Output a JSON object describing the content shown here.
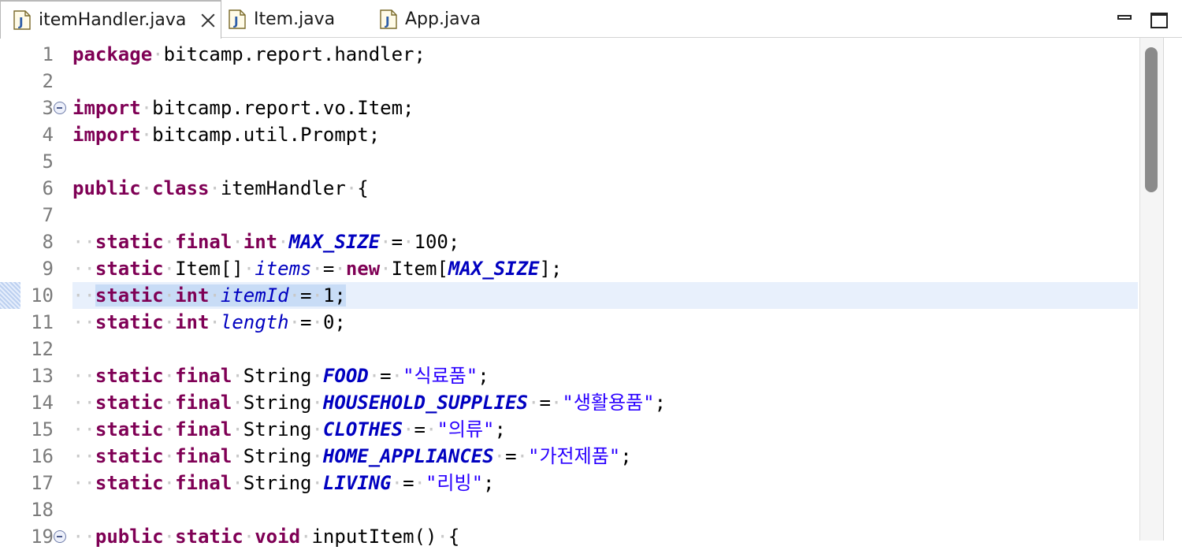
{
  "tabs": [
    {
      "label": "itemHandler.java",
      "active": true
    },
    {
      "label": "Item.java",
      "active": false
    },
    {
      "label": "App.java",
      "active": false
    }
  ],
  "icons": {
    "file": "java-file-icon",
    "close": "close-icon",
    "minimize": "minimize-icon",
    "maximize": "maximize-icon"
  },
  "colors": {
    "keyword": "#7f0055",
    "field": "#0000c0",
    "string": "#2a00ff",
    "current_line": "#e8f0fc"
  },
  "editor": {
    "current_line": 10,
    "lines": [
      {
        "n": "1",
        "tokens": [
          [
            "kw",
            "package"
          ],
          [
            "ws",
            "·"
          ],
          [
            "",
            "bitcamp.report.handler;"
          ]
        ]
      },
      {
        "n": "2",
        "tokens": []
      },
      {
        "n": "3",
        "fold": true,
        "tokens": [
          [
            "kw",
            "import"
          ],
          [
            "ws",
            "·"
          ],
          [
            "",
            "bitcamp.report.vo.Item;"
          ]
        ]
      },
      {
        "n": "4",
        "tokens": [
          [
            "kw",
            "import"
          ],
          [
            "ws",
            "·"
          ],
          [
            "",
            "bitcamp.util.Prompt;"
          ]
        ]
      },
      {
        "n": "5",
        "tokens": []
      },
      {
        "n": "6",
        "tokens": [
          [
            "kw",
            "public"
          ],
          [
            "ws",
            "·"
          ],
          [
            "kw",
            "class"
          ],
          [
            "ws",
            "·"
          ],
          [
            "",
            "itemHandler"
          ],
          [
            "ws",
            "·"
          ],
          [
            "",
            "{"
          ]
        ]
      },
      {
        "n": "7",
        "tokens": []
      },
      {
        "n": "8",
        "tokens": [
          [
            "ws",
            "··"
          ],
          [
            "kw",
            "static"
          ],
          [
            "ws",
            "·"
          ],
          [
            "kw",
            "final"
          ],
          [
            "ws",
            "·"
          ],
          [
            "kw",
            "int"
          ],
          [
            "ws",
            "·"
          ],
          [
            "fsi",
            "MAX_SIZE"
          ],
          [
            "ws",
            "·"
          ],
          [
            "",
            "="
          ],
          [
            "ws",
            "·"
          ],
          [
            "",
            "100;"
          ]
        ]
      },
      {
        "n": "9",
        "tokens": [
          [
            "ws",
            "··"
          ],
          [
            "kw",
            "static"
          ],
          [
            "ws",
            "·"
          ],
          [
            "",
            "Item[]"
          ],
          [
            "ws",
            "·"
          ],
          [
            "fi",
            "items"
          ],
          [
            "ws",
            "·"
          ],
          [
            "",
            "="
          ],
          [
            "ws",
            "·"
          ],
          [
            "kw",
            "new"
          ],
          [
            "ws",
            "·"
          ],
          [
            "",
            "Item["
          ],
          [
            "fsi",
            "MAX_SIZE"
          ],
          [
            "",
            "];"
          ]
        ]
      },
      {
        "n": "10",
        "tokens": [
          [
            "ws",
            "··"
          ],
          [
            "kw sel",
            "static"
          ],
          [
            "ws sel",
            "·"
          ],
          [
            "kw sel",
            "int"
          ],
          [
            "ws sel",
            "·"
          ],
          [
            "fi sel",
            "itemId"
          ],
          [
            "ws sel",
            "·"
          ],
          [
            "sel",
            "="
          ],
          [
            "ws sel",
            "·"
          ],
          [
            "sel",
            "1;"
          ]
        ]
      },
      {
        "n": "11",
        "tokens": [
          [
            "ws",
            "··"
          ],
          [
            "kw",
            "static"
          ],
          [
            "ws",
            "·"
          ],
          [
            "kw",
            "int"
          ],
          [
            "ws",
            "·"
          ],
          [
            "fi",
            "length"
          ],
          [
            "ws",
            "·"
          ],
          [
            "",
            "="
          ],
          [
            "ws",
            "·"
          ],
          [
            "",
            "0;"
          ]
        ]
      },
      {
        "n": "12",
        "tokens": []
      },
      {
        "n": "13",
        "tokens": [
          [
            "ws",
            "··"
          ],
          [
            "kw",
            "static"
          ],
          [
            "ws",
            "·"
          ],
          [
            "kw",
            "final"
          ],
          [
            "ws",
            "·"
          ],
          [
            "",
            "String"
          ],
          [
            "ws",
            "·"
          ],
          [
            "fsi",
            "FOOD"
          ],
          [
            "ws",
            "·"
          ],
          [
            "",
            "="
          ],
          [
            "ws",
            "·"
          ],
          [
            "str",
            "\"식료품\""
          ],
          [
            "",
            ";"
          ]
        ]
      },
      {
        "n": "14",
        "tokens": [
          [
            "ws",
            "··"
          ],
          [
            "kw",
            "static"
          ],
          [
            "ws",
            "·"
          ],
          [
            "kw",
            "final"
          ],
          [
            "ws",
            "·"
          ],
          [
            "",
            "String"
          ],
          [
            "ws",
            "·"
          ],
          [
            "fsi",
            "HOUSEHOLD_SUPPLIES"
          ],
          [
            "ws",
            "·"
          ],
          [
            "",
            "="
          ],
          [
            "ws",
            "·"
          ],
          [
            "str",
            "\"생활용품\""
          ],
          [
            "",
            ";"
          ]
        ]
      },
      {
        "n": "15",
        "tokens": [
          [
            "ws",
            "··"
          ],
          [
            "kw",
            "static"
          ],
          [
            "ws",
            "·"
          ],
          [
            "kw",
            "final"
          ],
          [
            "ws",
            "·"
          ],
          [
            "",
            "String"
          ],
          [
            "ws",
            "·"
          ],
          [
            "fsi",
            "CLOTHES"
          ],
          [
            "ws",
            "·"
          ],
          [
            "",
            "="
          ],
          [
            "ws",
            "·"
          ],
          [
            "str",
            "\"의류\""
          ],
          [
            "",
            ";"
          ]
        ]
      },
      {
        "n": "16",
        "tokens": [
          [
            "ws",
            "··"
          ],
          [
            "kw",
            "static"
          ],
          [
            "ws",
            "·"
          ],
          [
            "kw",
            "final"
          ],
          [
            "ws",
            "·"
          ],
          [
            "",
            "String"
          ],
          [
            "ws",
            "·"
          ],
          [
            "fsi",
            "HOME_APPLIANCES"
          ],
          [
            "ws",
            "·"
          ],
          [
            "",
            "="
          ],
          [
            "ws",
            "·"
          ],
          [
            "str",
            "\"가전제품\""
          ],
          [
            "",
            ";"
          ]
        ]
      },
      {
        "n": "17",
        "tokens": [
          [
            "ws",
            "··"
          ],
          [
            "kw",
            "static"
          ],
          [
            "ws",
            "·"
          ],
          [
            "kw",
            "final"
          ],
          [
            "ws",
            "·"
          ],
          [
            "",
            "String"
          ],
          [
            "ws",
            "·"
          ],
          [
            "fsi",
            "LIVING"
          ],
          [
            "ws",
            "·"
          ],
          [
            "",
            "="
          ],
          [
            "ws",
            "·"
          ],
          [
            "str",
            "\"리빙\""
          ],
          [
            "",
            ";"
          ]
        ]
      },
      {
        "n": "18",
        "tokens": []
      },
      {
        "n": "19",
        "fold": true,
        "tokens": [
          [
            "ws",
            "··"
          ],
          [
            "kw",
            "public"
          ],
          [
            "ws",
            "·"
          ],
          [
            "kw",
            "static"
          ],
          [
            "ws",
            "·"
          ],
          [
            "kw",
            "void"
          ],
          [
            "ws",
            "·"
          ],
          [
            "",
            "inputItem()"
          ],
          [
            "ws",
            "·"
          ],
          [
            "",
            "{"
          ]
        ]
      }
    ]
  }
}
